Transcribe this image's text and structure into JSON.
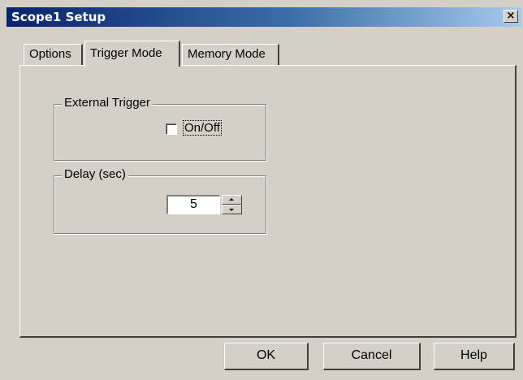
{
  "window": {
    "title": "Scope1 Setup",
    "close_glyph": "×"
  },
  "tabs": [
    {
      "label": "Options",
      "active": false
    },
    {
      "label": "Trigger Mode",
      "active": true
    },
    {
      "label": "Memory Mode",
      "active": false
    }
  ],
  "trigger_mode": {
    "external_trigger": {
      "group_label": "External Trigger",
      "checkbox_label": "On/Off",
      "checked": false
    },
    "delay": {
      "group_label": "Delay (sec)",
      "value": "5"
    }
  },
  "buttons": {
    "ok": "OK",
    "cancel": "Cancel",
    "help": "Help"
  }
}
